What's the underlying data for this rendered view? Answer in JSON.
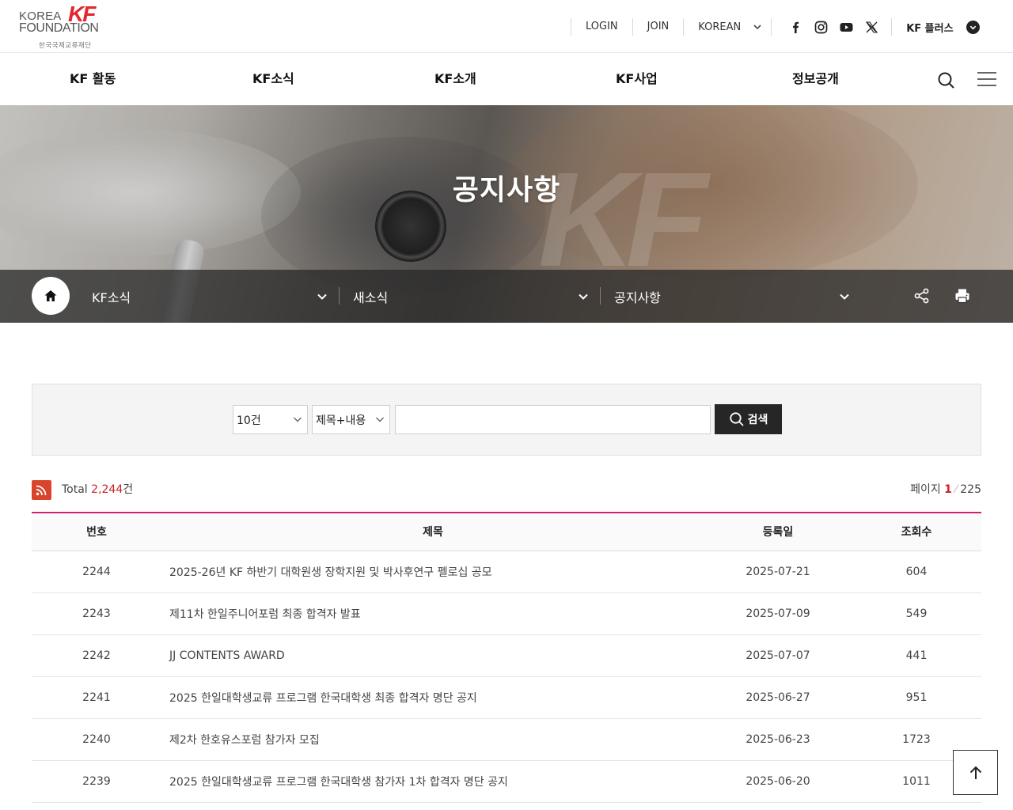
{
  "logo": {
    "line1": "KOREA",
    "line2": "FOUNDATION",
    "mark": "KF",
    "line3": "한국국제교류재단"
  },
  "util": {
    "login": "LOGIN",
    "join": "JOIN",
    "language": "KOREAN",
    "social_icons": [
      "facebook-icon",
      "instagram-icon",
      "youtube-icon",
      "x-icon"
    ],
    "kf_plus": "KF 플러스"
  },
  "gnb": {
    "items": [
      "KF 활동",
      "KF소식",
      "KF소개",
      "KF사업",
      "정보공개"
    ]
  },
  "hero": {
    "title": "공지사항",
    "watermark": "KF"
  },
  "location": {
    "level1": "KF소식",
    "level2": "새소식",
    "level3": "공지사항"
  },
  "search": {
    "page_size": "10건",
    "field": "제목+내용",
    "keyword": "",
    "submit_label": "검색"
  },
  "list_info": {
    "total_label": "Total",
    "total_count": "2,244",
    "total_unit": "건",
    "page_label": "페이지",
    "current_page": "1",
    "total_pages": "225"
  },
  "table": {
    "headers": {
      "no": "번호",
      "title": "제목",
      "date": "등록일",
      "hits": "조회수"
    },
    "rows": [
      {
        "no": "2244",
        "title": "2025-26년 KF 하반기 대학원생 장학지원 및 박사후연구 펠로십 공모",
        "date": "2025-07-21",
        "hits": "604"
      },
      {
        "no": "2243",
        "title": "제11차 한일주니어포럼 최종 합격자 발표",
        "date": "2025-07-09",
        "hits": "549"
      },
      {
        "no": "2242",
        "title": "JJ CONTENTS AWARD",
        "date": "2025-07-07",
        "hits": "441"
      },
      {
        "no": "2241",
        "title": "2025 한일대학생교류 프로그램 한국대학생 최종 합격자 명단 공지",
        "date": "2025-06-27",
        "hits": "951"
      },
      {
        "no": "2240",
        "title": "제2차 한호유스포럼 참가자 모집",
        "date": "2025-06-23",
        "hits": "1723"
      },
      {
        "no": "2239",
        "title": "2025 한일대학생교류 프로그램 한국대학생 참가자 1차 합격자 명단 공지",
        "date": "2025-06-20",
        "hits": "1011"
      }
    ]
  },
  "colors": {
    "brand_red": "#e4262f",
    "accent_pink": "#d01f6f",
    "count_red": "#d01f2a",
    "button_dark": "#262626"
  }
}
